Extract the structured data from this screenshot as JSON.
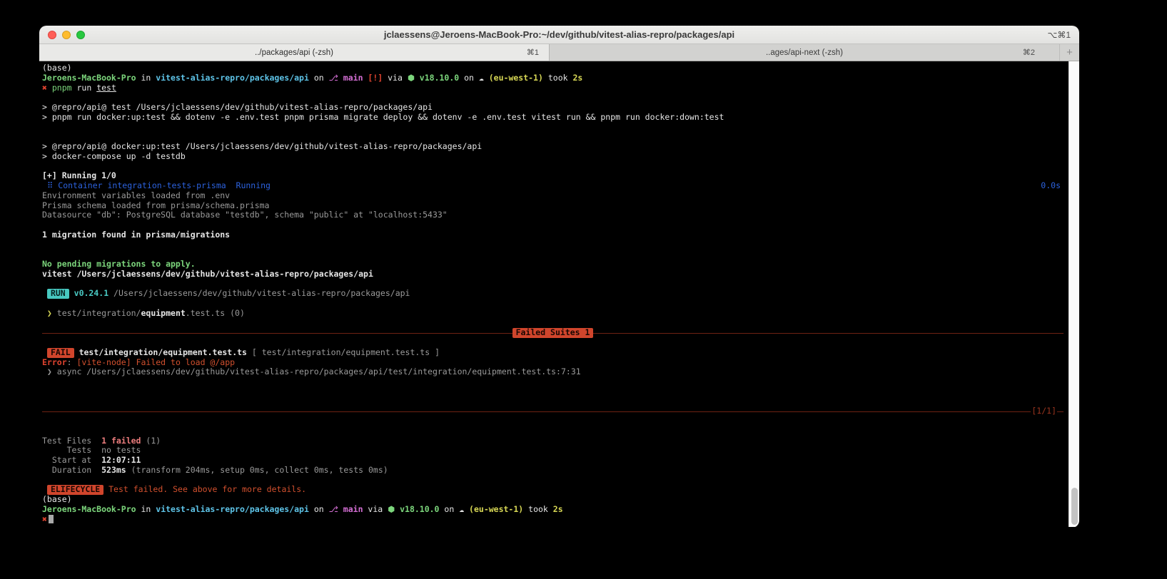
{
  "window": {
    "title": "jclaessens@Jeroens-MacBook-Pro:~/dev/github/vitest-alias-repro/packages/api",
    "title_shortcut": "⌥⌘1",
    "tabs": [
      {
        "label": "../packages/api (-zsh)",
        "shortcut": "⌘1"
      },
      {
        "label": "..ages/api-next (-zsh)",
        "shortcut": "⌘2"
      }
    ],
    "new_tab_label": "+"
  },
  "colors": {
    "prompt_green": "#7cd67c",
    "path_cyan": "#5ec4e8",
    "branch_magenta": "#d56fd5",
    "error_red": "#e0432f",
    "aws_yellow": "#d8d855",
    "docker_blue": "#2c62de",
    "vitest_teal": "#47c8c0",
    "fail_badge": "#d0452c",
    "divider_red": "#6e2213"
  },
  "terminal": {
    "lines": [
      {
        "segs": [
          {
            "t": "(base)",
            "s": "fg"
          }
        ]
      },
      {
        "segs": [
          {
            "t": "Jeroens-MacBook-Pro",
            "s": "green bold"
          },
          {
            "t": " in ",
            "s": "fg"
          },
          {
            "t": "vitest-alias-repro/packages/api",
            "s": "cyan bold"
          },
          {
            "t": " on ",
            "s": "fg"
          },
          {
            "t": "⎇ ",
            "s": "magenta"
          },
          {
            "t": "main",
            "s": "magenta bold"
          },
          {
            "t": " [!]",
            "s": "red bold"
          },
          {
            "t": " via ",
            "s": "fg"
          },
          {
            "t": "⬢ ",
            "s": "green"
          },
          {
            "t": "v18.10.0",
            "s": "green bold"
          },
          {
            "t": " on ",
            "s": "fg"
          },
          {
            "t": "☁ ",
            "s": "fg"
          },
          {
            "t": "(eu-west-1)",
            "s": "yellow bold"
          },
          {
            "t": " took ",
            "s": "fg"
          },
          {
            "t": "2s",
            "s": "yellow bold"
          }
        ]
      },
      {
        "segs": [
          {
            "t": "✖",
            "s": "red"
          },
          {
            "t": " pnpm",
            "s": "green"
          },
          {
            "t": " run ",
            "s": "fg"
          },
          {
            "t": "test",
            "s": "fg ul"
          }
        ]
      },
      {},
      {
        "segs": [
          {
            "t": "> @repro/api@ test /Users/jclaessens/dev/github/vitest-alias-repro/packages/api",
            "s": "fg"
          }
        ]
      },
      {
        "segs": [
          {
            "t": "> pnpm run docker:up:test && dotenv -e .env.test pnpm prisma migrate deploy && dotenv -e .env.test vitest run && pnpm run docker:down:test",
            "s": "fg"
          }
        ]
      },
      {},
      {},
      {
        "segs": [
          {
            "t": "> @repro/api@ docker:up:test /Users/jclaessens/dev/github/vitest-alias-repro/packages/api",
            "s": "fg"
          }
        ]
      },
      {
        "segs": [
          {
            "t": "> docker-compose up -d testdb",
            "s": "fg"
          }
        ]
      },
      {},
      {
        "segs": [
          {
            "t": "[+] Running 1/0",
            "s": "fg bold"
          }
        ]
      },
      {
        "segs": [
          {
            "t": "0.0s",
            "s": "blue fr"
          },
          {
            "t": " ⠿ Container integration-tests-prisma  Running",
            "s": "blue"
          }
        ]
      },
      {
        "segs": [
          {
            "t": "Environment variables loaded from .env",
            "s": "dim"
          }
        ]
      },
      {
        "segs": [
          {
            "t": "Prisma schema loaded from prisma/schema.prisma",
            "s": "dim"
          }
        ]
      },
      {
        "segs": [
          {
            "t": "Datasource \"db\": PostgreSQL database \"testdb\", schema \"public\" at \"localhost:5433\"",
            "s": "dim"
          }
        ]
      },
      {},
      {
        "segs": [
          {
            "t": "1 migration found in prisma/migrations",
            "s": "fg bold"
          }
        ]
      },
      {},
      {},
      {
        "segs": [
          {
            "t": "No pending migrations to apply.",
            "s": "green bold"
          }
        ]
      },
      {
        "segs": [
          {
            "t": "vitest /Users/jclaessens/dev/github/vitest-alias-repro/packages/api",
            "s": "fg bold"
          }
        ]
      },
      {},
      {
        "segs": [
          {
            "t": " ",
            "s": "fg"
          },
          {
            "t": "RUN",
            "s": "badge badge-run"
          },
          {
            "t": " ",
            "s": "fg"
          },
          {
            "t": "v0.24.1",
            "s": "teal bold"
          },
          {
            "t": " /Users/jclaessens/dev/github/vitest-alias-repro/packages/api",
            "s": "dim"
          }
        ]
      },
      {},
      {
        "segs": [
          {
            "t": " ❯ ",
            "s": "yellow"
          },
          {
            "t": "test/integration/",
            "s": "dim"
          },
          {
            "t": "equipment",
            "s": "fg bold"
          },
          {
            "t": ".test.ts",
            "s": "dim"
          },
          {
            "t": " (0)",
            "s": "dim"
          }
        ]
      },
      {},
      {
        "divider": "center",
        "badge": "Failed Suites 1"
      },
      {},
      {
        "segs": [
          {
            "t": " ",
            "s": "fg"
          },
          {
            "t": "FAIL",
            "s": "badge badge-fail"
          },
          {
            "t": " ",
            "s": "fg"
          },
          {
            "t": "test/integration/equipment.test.ts",
            "s": "fg bold"
          },
          {
            "t": " [ test/integration/equipment.test.ts ]",
            "s": "dim"
          }
        ]
      },
      {
        "segs": [
          {
            "t": "Error",
            "s": "red bold"
          },
          {
            "t": ": ",
            "s": "dim"
          },
          {
            "t": "[vite-node] Failed to load @/app",
            "s": "orangered"
          }
        ]
      },
      {
        "segs": [
          {
            "t": " ❯ async /Users/jclaessens/dev/github/vitest-alias-repro/packages/api/test/integration/equipment.test.ts:7:31",
            "s": "dim"
          }
        ]
      },
      {},
      {},
      {},
      {
        "divider": "right",
        "label": "[1/1]"
      },
      {},
      {},
      {
        "segs": [
          {
            "t": "Test Files  ",
            "s": "dim"
          },
          {
            "t": "1 failed",
            "s": "failred bold"
          },
          {
            "t": " (1)",
            "s": "dim"
          }
        ]
      },
      {
        "segs": [
          {
            "t": "     Tests  no tests",
            "s": "dim"
          }
        ]
      },
      {
        "segs": [
          {
            "t": "  Start at  ",
            "s": "dim"
          },
          {
            "t": "12:07:11",
            "s": "fg bold"
          }
        ]
      },
      {
        "segs": [
          {
            "t": "  Duration  ",
            "s": "dim"
          },
          {
            "t": "523ms",
            "s": "fg bold"
          },
          {
            "t": " (transform 204ms, setup 0ms, collect 0ms, tests 0ms)",
            "s": "dim"
          }
        ]
      },
      {},
      {
        "segs": [
          {
            "t": " ",
            "s": "fg"
          },
          {
            "t": "ELIFECYCLE",
            "s": "badge badge-fail"
          },
          {
            "t": " ",
            "s": "fg"
          },
          {
            "t": "Test failed. See above for more details.",
            "s": "orangered"
          }
        ]
      },
      {
        "segs": [
          {
            "t": "(base)",
            "s": "fg"
          }
        ]
      },
      {
        "segs": [
          {
            "t": "Jeroens-MacBook-Pro",
            "s": "green bold"
          },
          {
            "t": " in ",
            "s": "fg"
          },
          {
            "t": "vitest-alias-repro/packages/api",
            "s": "cyan bold"
          },
          {
            "t": " on ",
            "s": "fg"
          },
          {
            "t": "⎇ ",
            "s": "magenta"
          },
          {
            "t": "main",
            "s": "magenta bold"
          },
          {
            "t": " via ",
            "s": "fg"
          },
          {
            "t": "⬢ ",
            "s": "green"
          },
          {
            "t": "v18.10.0",
            "s": "green bold"
          },
          {
            "t": " on ",
            "s": "fg"
          },
          {
            "t": "☁ ",
            "s": "fg"
          },
          {
            "t": "(eu-west-1)",
            "s": "yellow bold"
          },
          {
            "t": " took ",
            "s": "fg"
          },
          {
            "t": "2s",
            "s": "yellow bold"
          }
        ]
      },
      {
        "segs": [
          {
            "t": "✖",
            "s": "red"
          }
        ],
        "cursor": true
      }
    ]
  }
}
